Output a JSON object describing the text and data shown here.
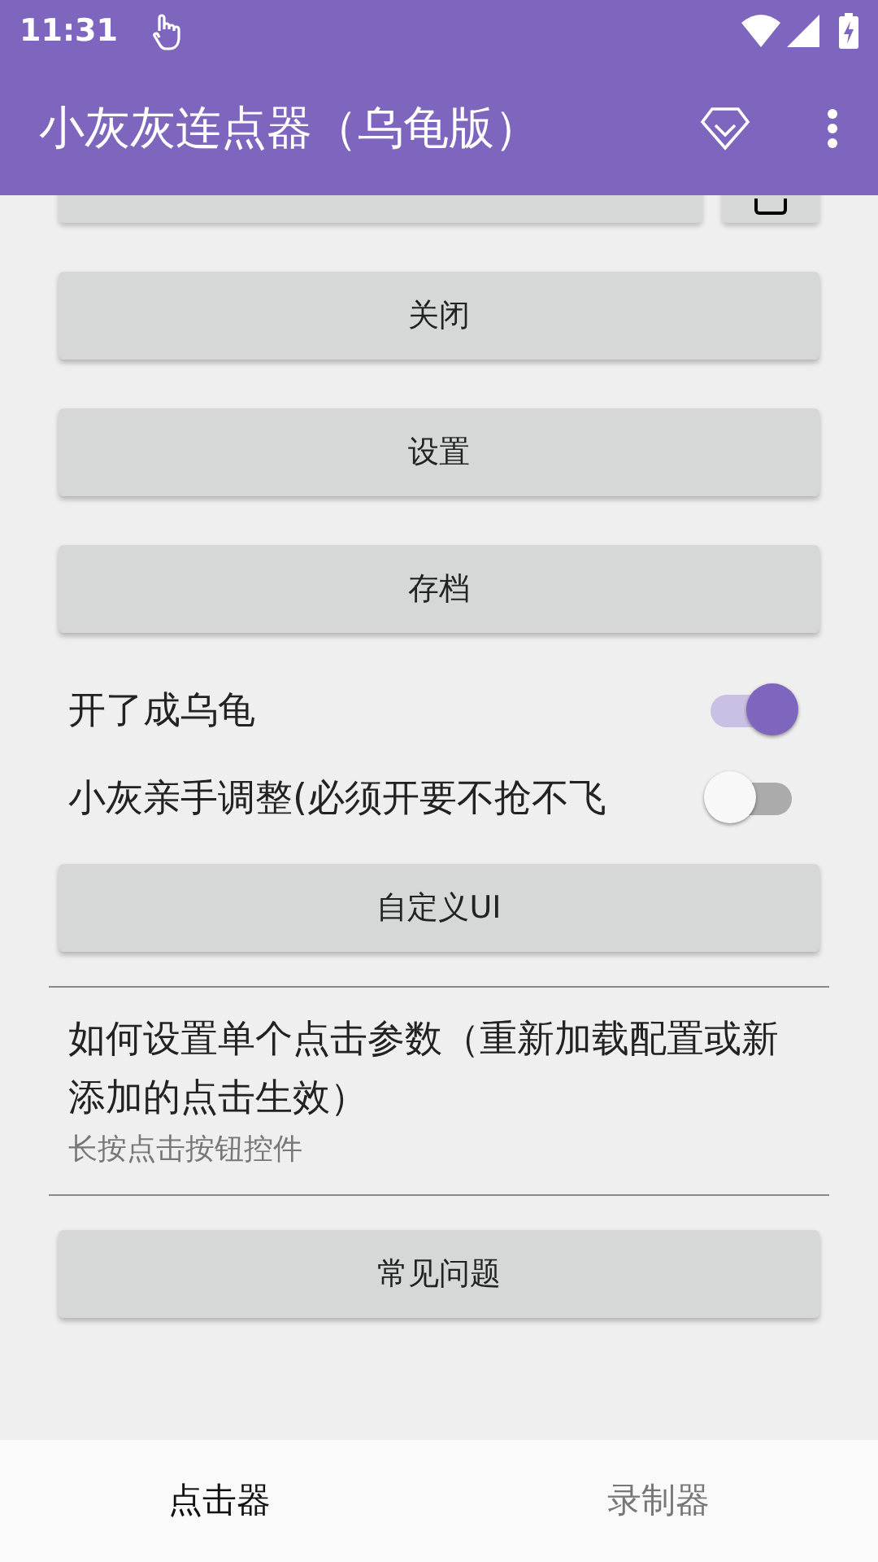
{
  "status_bar": {
    "time": "11:31"
  },
  "app_bar": {
    "title": "小灰灰连点器（乌龟版）"
  },
  "buttons_top": [
    {
      "label": "关闭"
    },
    {
      "label": "设置"
    },
    {
      "label": "存档"
    }
  ],
  "switches": [
    {
      "label": "开了成乌龟",
      "on": true
    },
    {
      "label": "小灰亲手调整(必须开要不抢不飞",
      "on": false
    }
  ],
  "custom_button": {
    "label": "自定义UI"
  },
  "help": {
    "title": "如何设置单个点击参数（重新加载配置或新添加的点击生效）",
    "subtitle": "长按点击按钮控件"
  },
  "faq_button": {
    "label": "常见问题"
  },
  "bottom_tabs": [
    {
      "label": "点击器",
      "selected": true
    },
    {
      "label": "录制器",
      "selected": false
    }
  ]
}
